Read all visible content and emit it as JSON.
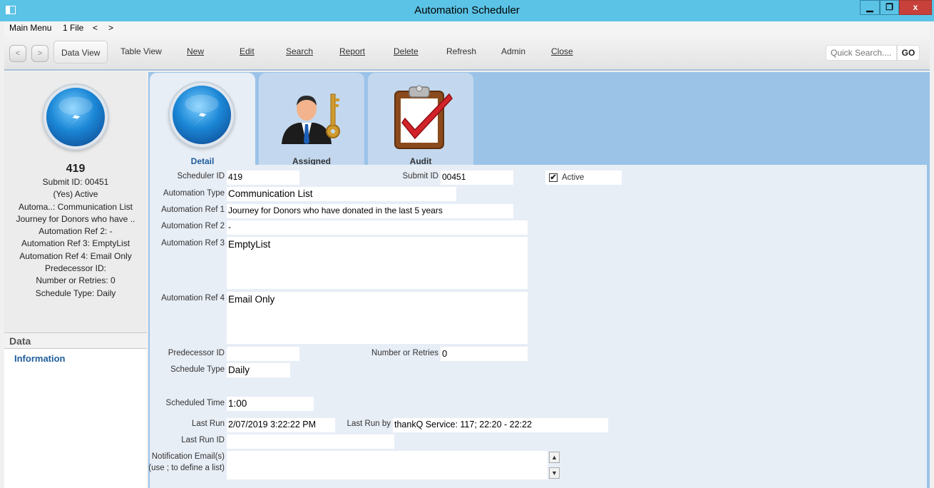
{
  "window": {
    "title": "Automation Scheduler",
    "min": "▁",
    "max": "❐",
    "close": "x"
  },
  "menubar": {
    "main_menu": "Main Menu",
    "file": "1 File",
    "back": "<",
    "forward": ">"
  },
  "toolbar": {
    "prev": "<",
    "next": ">",
    "data_view": "Data View",
    "table_view": "Table View",
    "new": "New",
    "edit": "Edit",
    "search": "Search",
    "report": "Report",
    "delete": "Delete",
    "refresh": "Refresh",
    "admin": "Admin",
    "close": "Close",
    "quick_search_placeholder": "Quick Search....",
    "go": "GO"
  },
  "left": {
    "record_id": "419",
    "summary": [
      "Submit ID: 00451",
      "(Yes) Active",
      "Automa..: Communication List",
      "Journey for Donors who have ..",
      "Automation Ref 2: -",
      "Automation Ref 3: EmptyList",
      "Automation Ref 4: Email Only",
      "Predecessor ID:",
      "Number or Retries: 0",
      "Schedule Type: Daily"
    ],
    "data_header": "Data",
    "information": "Information"
  },
  "tabs": {
    "detail": "Detail",
    "assigned": "Assigned",
    "audit": "Audit"
  },
  "form": {
    "labels": {
      "scheduler_id": "Scheduler ID",
      "submit_id": "Submit ID",
      "active": "Active",
      "automation_type": "Automation Type",
      "ref1": "Automation Ref 1",
      "ref2": "Automation Ref 2",
      "ref3": "Automation Ref 3",
      "ref4": "Automation Ref 4",
      "predecessor_id": "Predecessor ID",
      "number_retries": "Number or Retries",
      "schedule_type": "Schedule Type",
      "scheduled_time": "Scheduled Time",
      "last_run": "Last Run",
      "last_run_by": "Last Run by",
      "last_run_id": "Last Run ID",
      "notification_email": "Notification Email(s)",
      "notification_hint": "(use ; to define a list)"
    },
    "values": {
      "scheduler_id": "419",
      "submit_id": "00451",
      "active_checked": "✔",
      "automation_type": "Communication List",
      "ref1": "Journey for Donors who have donated in the last 5 years",
      "ref2": "-",
      "ref3": "EmptyList",
      "ref4": "Email Only",
      "predecessor_id": "",
      "number_retries": "0",
      "schedule_type": "Daily",
      "scheduled_time": "1:00",
      "last_run": "2/07/2019 3:22:22 PM",
      "last_run_by": "thankQ Service: 117; 22:20 - 22:22",
      "last_run_id": "",
      "notification_email": ""
    },
    "scroll_up": "▲",
    "scroll_down": "▼"
  },
  "colors": {
    "titlebar": "#5bc3e6",
    "close": "#c7413a",
    "accent": "#1f5d9c",
    "panel_bg": "#9bc3e8",
    "form_bg": "#e8eef6"
  }
}
